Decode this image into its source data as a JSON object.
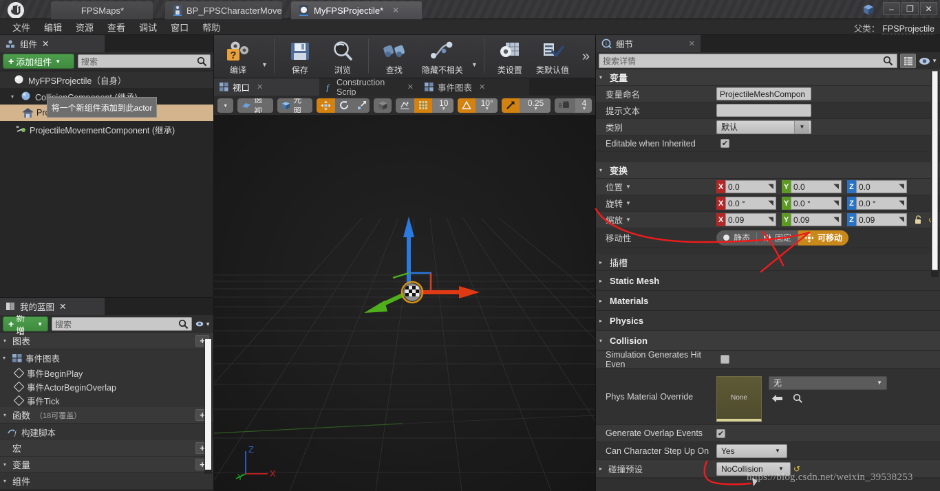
{
  "window": {
    "title_tabs": [
      {
        "label": "FPSMaps*",
        "icon": "map-icon",
        "active": false,
        "closable": false
      },
      {
        "label": "BP_FPSCharacterMove",
        "icon": "blueprint-character-icon",
        "active": false,
        "closable": true
      },
      {
        "label": "MyFPSProjectile*",
        "icon": "blueprint-sphere-icon",
        "active": true,
        "closable": true
      }
    ],
    "minimize": "–",
    "maximize": "❐",
    "close": "✕"
  },
  "menubar": {
    "items": [
      "文件",
      "编辑",
      "资源",
      "查看",
      "调试",
      "窗口",
      "帮助"
    ]
  },
  "parent_class": {
    "label": "父类：",
    "value": "FPSProjectile"
  },
  "components_panel": {
    "tab_label": "组件",
    "add_button": "添加组件",
    "search_placeholder": "搜索",
    "tooltip": "将一个新组件添加到此actor",
    "tree": [
      {
        "label": "MyFPSProjectile（自身）",
        "icon": "sphere-icon",
        "depth": 0,
        "expander": "",
        "selected": false,
        "root": true
      },
      {
        "label": "CollisionComponent (继承)",
        "icon": "sphere-icon",
        "depth": 1,
        "expander": "▾",
        "selected": false,
        "root": false
      },
      {
        "label": "ProjectileMeshComponent",
        "icon": "mesh-icon",
        "depth": 2,
        "expander": "",
        "selected": true,
        "root": false
      },
      {
        "label": "ProjectileMovementComponent (继承)",
        "icon": "movement-icon",
        "depth": 1,
        "expander": "",
        "selected": false,
        "root": false
      }
    ]
  },
  "myblueprint_panel": {
    "tab_label": "我的蓝图",
    "add_button": "新增",
    "search_placeholder": "搜索",
    "sections": [
      {
        "type": "category",
        "label": "图表",
        "count": "",
        "plus": "+",
        "expander": "▾"
      },
      {
        "type": "subgroup",
        "label": "事件图表",
        "icon": "graph-icon",
        "expander": "▾"
      },
      {
        "type": "item",
        "label": "事件BeginPlay",
        "icon": "event-node-icon"
      },
      {
        "type": "item",
        "label": "事件ActorBeginOverlap",
        "icon": "event-node-icon"
      },
      {
        "type": "item",
        "label": "事件Tick",
        "icon": "event-node-icon"
      },
      {
        "type": "category",
        "label": "函数",
        "count": "（18可覆盖）",
        "plus": "+",
        "expander": "▾"
      },
      {
        "type": "subgroup",
        "label": "构建脚本",
        "icon": "function-icon",
        "expander": ""
      },
      {
        "type": "category",
        "label": "宏",
        "count": "",
        "plus": "+",
        "expander": ""
      },
      {
        "type": "category",
        "label": "变量",
        "count": "",
        "plus": "+",
        "expander": "▾"
      },
      {
        "type": "category-plain",
        "label": "组件",
        "count": "",
        "plus": "",
        "expander": "▾"
      }
    ]
  },
  "main_toolbar": {
    "buttons": [
      {
        "label": "编译",
        "icon": "compile-icon",
        "has_caret": true
      },
      {
        "label": "保存",
        "icon": "save-icon",
        "has_caret": false
      },
      {
        "label": "浏览",
        "icon": "browse-icon",
        "has_caret": false
      },
      {
        "label": "查找",
        "icon": "find-icon",
        "has_caret": false
      },
      {
        "label": "隐藏不相关",
        "icon": "hide-unrelated-icon",
        "has_caret": true
      },
      {
        "label": "类设置",
        "icon": "class-settings-icon",
        "has_caret": false
      },
      {
        "label": "类默认值",
        "icon": "class-defaults-icon",
        "has_caret": false
      }
    ],
    "overflow": "»"
  },
  "viewport_tabs": [
    {
      "label": "视口",
      "icon": "viewport-icon",
      "active": true
    },
    {
      "label": "Construction Scrip",
      "icon": "function-f-icon",
      "active": false
    },
    {
      "label": "事件图表",
      "icon": "graph-icon",
      "active": false
    }
  ],
  "viewport_toolbar": {
    "menu_caret": "▾",
    "perspective": "透视",
    "lighting": "光照",
    "transform_modes": [
      "move-gizmo-icon",
      "rotate-gizmo-icon",
      "scale-gizmo-icon"
    ],
    "coord_space": "world-cube-icon",
    "surface_snap": "surface-snap-icon",
    "grid_snap_icon": "grid-icon",
    "grid_snap_value": "10",
    "angle_snap_icon": "angle-icon",
    "angle_snap_value": "10°",
    "scale_snap_icon": "scale-snap-icon",
    "scale_snap_value": "0.25",
    "camera_speed_icon": "camera-icon",
    "camera_speed_value": "4"
  },
  "viewport": {
    "axis_x": "X",
    "axis_y": "Y",
    "axis_z": "Z"
  },
  "details_panel": {
    "tab_label": "细节",
    "search_placeholder": "搜索详情",
    "sections": [
      {
        "name": "变量",
        "expanded": true,
        "rows": [
          {
            "label": "变量命名",
            "type": "text",
            "value": "ProjectileMeshCompon"
          },
          {
            "label": "提示文本",
            "type": "text",
            "value": ""
          },
          {
            "label": "类别",
            "type": "combo",
            "value": "默认"
          },
          {
            "label": "Editable when Inherited",
            "type": "checkbox",
            "value": true
          }
        ]
      },
      {
        "name": "变换",
        "expanded": true,
        "rows": [
          {
            "label": "位置",
            "type": "vector",
            "expander": "▾",
            "x": "0.0",
            "y": "0.0",
            "z": "0.0"
          },
          {
            "label": "旋转",
            "type": "vector",
            "expander": "▾",
            "x": "0.0 °",
            "y": "0.0 °",
            "z": "0.0 °"
          },
          {
            "label": "缩放",
            "type": "vector",
            "expander": "▾",
            "x": "0.09",
            "y": "0.09",
            "z": "0.09",
            "lock": true,
            "reset": true
          },
          {
            "label": "移动性",
            "type": "mobility",
            "options": [
              "静态",
              "固定",
              "可移动"
            ],
            "selected": "可移动"
          }
        ]
      },
      {
        "name": "插槽",
        "expanded": false,
        "rows": []
      },
      {
        "name": "Static Mesh",
        "expanded": false,
        "rows": []
      },
      {
        "name": "Materials",
        "expanded": false,
        "rows": []
      },
      {
        "name": "Physics",
        "expanded": false,
        "rows": []
      },
      {
        "name": "Collision",
        "expanded": true,
        "rows": [
          {
            "label": "Simulation Generates Hit Even",
            "type": "checkbox",
            "value": false
          },
          {
            "label": "Phys Material Override",
            "type": "asset",
            "thumb_label": "None",
            "value": "无"
          },
          {
            "label": "Generate Overlap Events",
            "type": "checkbox",
            "value": true
          },
          {
            "label": "Can Character Step Up On",
            "type": "combo",
            "value": "Yes"
          },
          {
            "label": "碰撞预设",
            "type": "combo-dark",
            "value": "NoCollision",
            "expander": "▸",
            "reset": true
          }
        ]
      }
    ]
  },
  "annotations": {
    "watermark": "https://blog.csdn.net/weixin_39538253",
    "accent_red": "#ee1c1c",
    "accent_orange": "#c8891a",
    "accent_green": "#4d9e4d"
  }
}
